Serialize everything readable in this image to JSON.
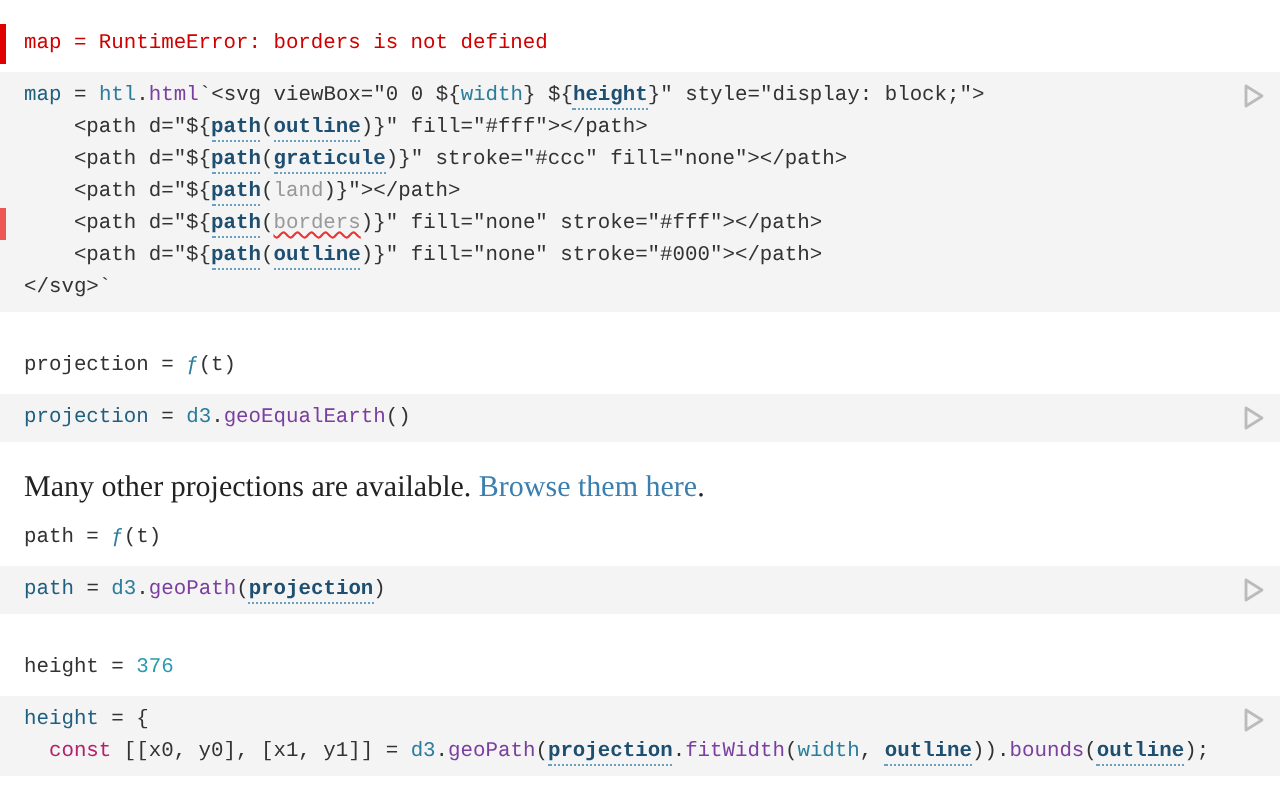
{
  "cells": [
    {
      "kind": "code",
      "output": {
        "error": true,
        "tokens": [
          {
            "kind": "plain",
            "text": "map = RuntimeError: borders is not defined"
          }
        ]
      },
      "lines": [
        {
          "flagged": false,
          "tokens": [
            {
              "kind": "def",
              "text": "map"
            },
            {
              "kind": "plain",
              "text": " = "
            },
            {
              "kind": "global",
              "text": "htl"
            },
            {
              "kind": "plain",
              "text": "."
            },
            {
              "kind": "prop",
              "text": "html"
            },
            {
              "kind": "plain",
              "text": "`<svg viewBox=\"0 0 ${"
            },
            {
              "kind": "global",
              "text": "width"
            },
            {
              "kind": "plain",
              "text": "} ${"
            },
            {
              "kind": "ref",
              "text": "height"
            },
            {
              "kind": "plain",
              "text": "}\" style=\"display: block;\">"
            }
          ]
        },
        {
          "flagged": false,
          "tokens": [
            {
              "kind": "plain",
              "text": "    <path d=\"${"
            },
            {
              "kind": "ref",
              "text": "path"
            },
            {
              "kind": "plain",
              "text": "("
            },
            {
              "kind": "ref",
              "text": "outline"
            },
            {
              "kind": "plain",
              "text": ")}\" fill=\"#fff\"></path>"
            }
          ]
        },
        {
          "flagged": false,
          "tokens": [
            {
              "kind": "plain",
              "text": "    <path d=\"${"
            },
            {
              "kind": "ref",
              "text": "path"
            },
            {
              "kind": "plain",
              "text": "("
            },
            {
              "kind": "ref",
              "text": "graticule"
            },
            {
              "kind": "plain",
              "text": ")}\" stroke=\"#ccc\" fill=\"none\"></path>"
            }
          ]
        },
        {
          "flagged": false,
          "tokens": [
            {
              "kind": "plain",
              "text": "    <path d=\"${"
            },
            {
              "kind": "ref",
              "text": "path"
            },
            {
              "kind": "plain",
              "text": "("
            },
            {
              "kind": "unresolved",
              "text": "land"
            },
            {
              "kind": "plain",
              "text": ")}\"></path>"
            }
          ]
        },
        {
          "flagged": true,
          "tokens": [
            {
              "kind": "plain",
              "text": "    <path d=\"${"
            },
            {
              "kind": "ref",
              "text": "path"
            },
            {
              "kind": "plain",
              "text": "("
            },
            {
              "kind": "undefined",
              "text": "borders"
            },
            {
              "kind": "plain",
              "text": ")}\" fill=\"none\" stroke=\"#fff\"></path>"
            }
          ]
        },
        {
          "flagged": false,
          "tokens": [
            {
              "kind": "plain",
              "text": "    <path d=\"${"
            },
            {
              "kind": "ref",
              "text": "path"
            },
            {
              "kind": "plain",
              "text": "("
            },
            {
              "kind": "ref",
              "text": "outline"
            },
            {
              "kind": "plain",
              "text": ")}\" fill=\"none\" stroke=\"#000\"></path>"
            }
          ]
        },
        {
          "flagged": false,
          "tokens": [
            {
              "kind": "plain",
              "text": "</svg>`"
            }
          ]
        }
      ]
    },
    {
      "kind": "code",
      "output": {
        "error": false,
        "tokens": [
          {
            "kind": "plain",
            "text": "projection = "
          },
          {
            "kind": "global",
            "text": "ƒ"
          },
          {
            "kind": "plain",
            "text": "(t)"
          }
        ]
      },
      "lines": [
        {
          "flagged": false,
          "tokens": [
            {
              "kind": "def",
              "text": "projection"
            },
            {
              "kind": "plain",
              "text": " = "
            },
            {
              "kind": "global",
              "text": "d3"
            },
            {
              "kind": "plain",
              "text": "."
            },
            {
              "kind": "prop",
              "text": "geoEqualEarth"
            },
            {
              "kind": "plain",
              "text": "()"
            }
          ]
        }
      ]
    },
    {
      "kind": "text",
      "text": "Many other projections are available.",
      "link": "Browse them here",
      "after": "."
    },
    {
      "kind": "code",
      "output": {
        "error": false,
        "tokens": [
          {
            "kind": "plain",
            "text": "path = "
          },
          {
            "kind": "global",
            "text": "ƒ"
          },
          {
            "kind": "plain",
            "text": "(t)"
          }
        ]
      },
      "lines": [
        {
          "flagged": false,
          "tokens": [
            {
              "kind": "def",
              "text": "path"
            },
            {
              "kind": "plain",
              "text": " = "
            },
            {
              "kind": "global",
              "text": "d3"
            },
            {
              "kind": "plain",
              "text": "."
            },
            {
              "kind": "prop",
              "text": "geoPath"
            },
            {
              "kind": "plain",
              "text": "("
            },
            {
              "kind": "ref",
              "text": "projection"
            },
            {
              "kind": "plain",
              "text": ")"
            }
          ]
        }
      ]
    },
    {
      "kind": "code",
      "output": {
        "error": false,
        "tokens": [
          {
            "kind": "plain",
            "text": "height = "
          },
          {
            "kind": "number",
            "text": "376"
          }
        ]
      },
      "lines": [
        {
          "flagged": false,
          "tokens": [
            {
              "kind": "def",
              "text": "height"
            },
            {
              "kind": "plain",
              "text": " = {"
            }
          ]
        },
        {
          "flagged": false,
          "tokens": [
            {
              "kind": "keyword",
              "text": "  const"
            },
            {
              "kind": "plain",
              "text": " [[x0, y0], [x1, y1]] = "
            },
            {
              "kind": "global",
              "text": "d3"
            },
            {
              "kind": "plain",
              "text": "."
            },
            {
              "kind": "prop",
              "text": "geoPath"
            },
            {
              "kind": "plain",
              "text": "("
            },
            {
              "kind": "ref",
              "text": "projection"
            },
            {
              "kind": "plain",
              "text": "."
            },
            {
              "kind": "prop",
              "text": "fitWidth"
            },
            {
              "kind": "plain",
              "text": "("
            },
            {
              "kind": "global",
              "text": "width"
            },
            {
              "kind": "plain",
              "text": ", "
            },
            {
              "kind": "ref",
              "text": "outline"
            },
            {
              "kind": "plain",
              "text": "))."
            },
            {
              "kind": "prop",
              "text": "bounds"
            },
            {
              "kind": "plain",
              "text": "("
            },
            {
              "kind": "ref",
              "text": "outline"
            },
            {
              "kind": "plain",
              "text": ");"
            }
          ]
        }
      ]
    }
  ]
}
